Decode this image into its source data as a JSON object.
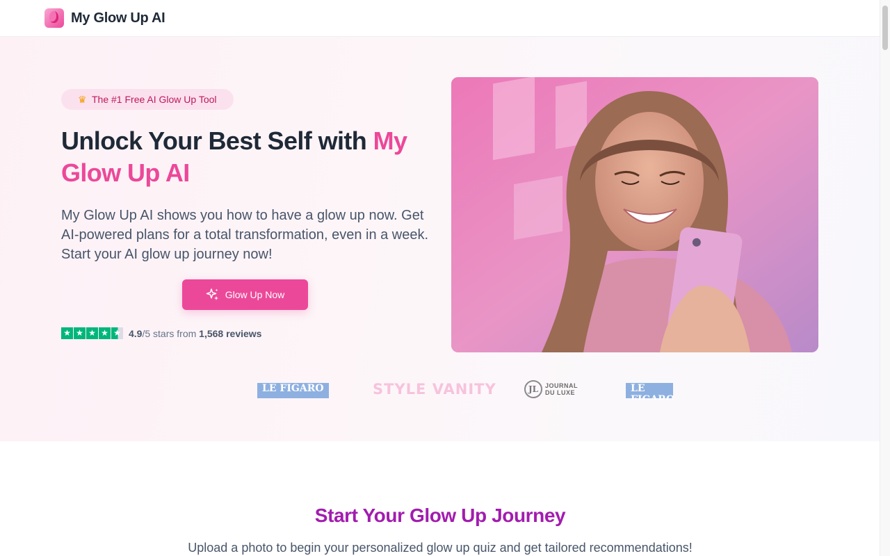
{
  "header": {
    "brand_name": "My Glow Up AI",
    "logo_icon": "glow-up-logo"
  },
  "hero": {
    "badge": "The #1 Free AI Glow Up Tool",
    "title_main": "Unlock Your Best Self with ",
    "title_highlight": "My Glow Up AI",
    "description": "My Glow Up AI shows you how to have a glow up now. Get AI-powered plans for a total transformation, even in a week. Start your AI glow up journey now!",
    "cta_label": "Glow Up Now",
    "rating": {
      "stars_filled": 4.5,
      "score": "4.9",
      "score_suffix": "/5 stars from ",
      "reviews": "1,568 reviews"
    }
  },
  "press_logos": [
    "LE FIGARO",
    "STYLE VANITY",
    "JOURNAL",
    "DU LUXE",
    "LE FIGARO"
  ],
  "section": {
    "title": "Start Your Glow Up Journey",
    "subtitle": "Upload a photo to begin your personalized glow up quiz and get tailored recommendations!"
  },
  "colors": {
    "accent": "#ec4899",
    "section_title": "#a21caf",
    "trust_green": "#00b67a"
  }
}
